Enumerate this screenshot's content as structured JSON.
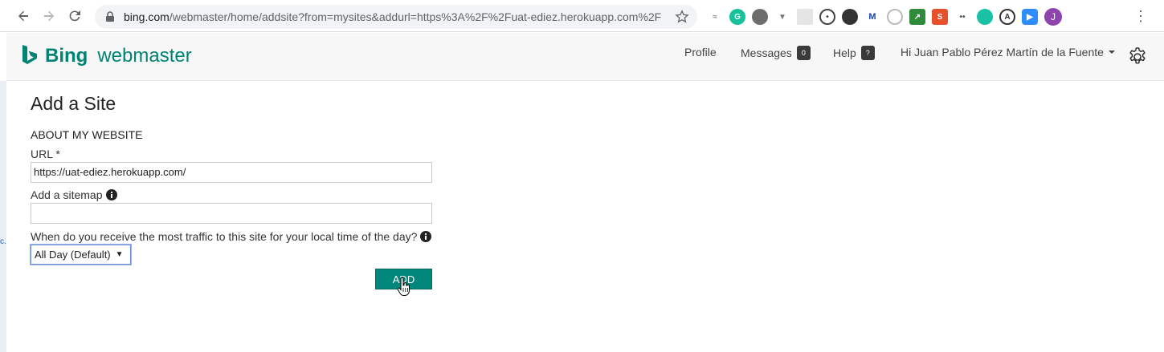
{
  "browser": {
    "url_host": "bing.com",
    "url_rest": "/webmaster/home/addsite?from=mysites&addurl=https%3A%2F%2Fuat-ediez.herokuapp.com%2F",
    "profile_initial": "J"
  },
  "header": {
    "logo_brand": "Bing",
    "logo_product": "webmaster",
    "nav": {
      "profile": "Profile",
      "messages": "Messages",
      "messages_count": "0",
      "help": "Help",
      "help_badge": "?",
      "user": "Hi Juan Pablo Pérez Martín de la Fuente"
    }
  },
  "page": {
    "title": "Add a Site",
    "section": "ABOUT MY WEBSITE",
    "url_label": "URL *",
    "url_value": "https://uat-ediez.herokuapp.com/",
    "sitemap_label": "Add a sitemap",
    "sitemap_value": "",
    "traffic_label": "When do you receive the most traffic to this site for your local time of the day?",
    "traffic_selected": "All Day (Default)",
    "add_button": "ADD"
  },
  "colors": {
    "brand": "#008373",
    "button": "#00867a",
    "badge": "#3a3a3a"
  }
}
